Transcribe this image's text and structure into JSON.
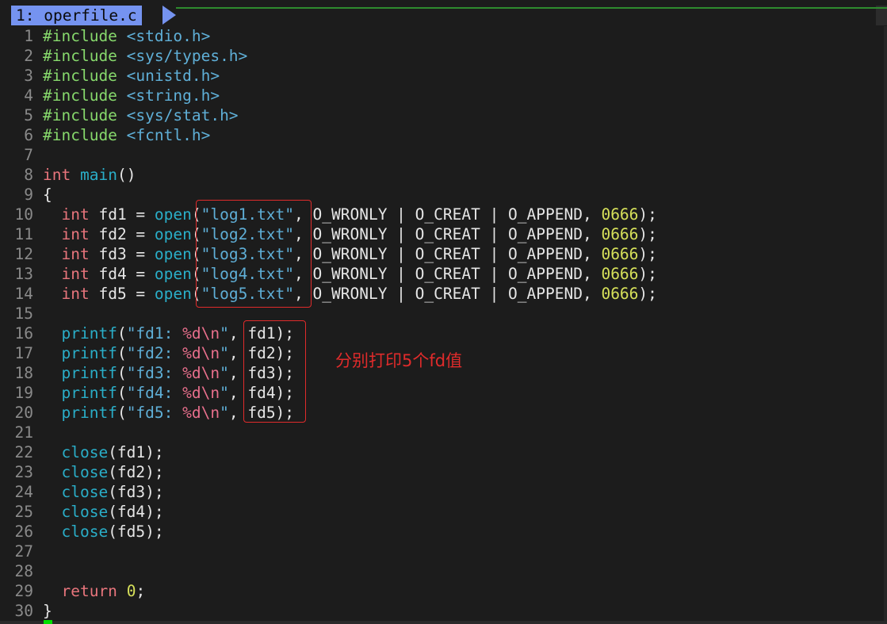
{
  "tabline": {
    "active_tab": "1: operfile.c"
  },
  "annotation": {
    "note": "分别打印5个fd值"
  },
  "colors": {
    "tab_active": "#7593f0",
    "preprocessor": "#87d96c",
    "include_path": "#5fafd7",
    "keyword": "#e8757c",
    "function": "#2aaec8",
    "string": "#5fafd7",
    "number": "#d6e05a",
    "format_spec": "#e86f8c",
    "annotation_red": "#e02b2b"
  },
  "lines": [
    {
      "n": "1",
      "tokens": [
        {
          "c": "pp",
          "t": "#include "
        },
        {
          "c": "inc",
          "t": "<stdio.h>"
        }
      ]
    },
    {
      "n": "2",
      "tokens": [
        {
          "c": "pp",
          "t": "#include "
        },
        {
          "c": "inc",
          "t": "<sys/types.h>"
        }
      ]
    },
    {
      "n": "3",
      "tokens": [
        {
          "c": "pp",
          "t": "#include "
        },
        {
          "c": "inc",
          "t": "<unistd.h>"
        }
      ]
    },
    {
      "n": "4",
      "tokens": [
        {
          "c": "pp",
          "t": "#include "
        },
        {
          "c": "inc",
          "t": "<string.h>"
        }
      ]
    },
    {
      "n": "5",
      "tokens": [
        {
          "c": "pp",
          "t": "#include "
        },
        {
          "c": "inc",
          "t": "<sys/stat.h>"
        }
      ]
    },
    {
      "n": "6",
      "tokens": [
        {
          "c": "pp",
          "t": "#include "
        },
        {
          "c": "inc",
          "t": "<fcntl.h>"
        }
      ]
    },
    {
      "n": "7",
      "tokens": []
    },
    {
      "n": "8",
      "tokens": [
        {
          "c": "kw",
          "t": "int"
        },
        {
          "c": "txt",
          "t": " "
        },
        {
          "c": "fn",
          "t": "main"
        },
        {
          "c": "txt",
          "t": "()"
        }
      ]
    },
    {
      "n": "9",
      "tokens": [
        {
          "c": "txt",
          "t": "{"
        }
      ]
    },
    {
      "n": "10",
      "tokens": [
        {
          "c": "txt",
          "t": "  "
        },
        {
          "c": "kw",
          "t": "int"
        },
        {
          "c": "txt",
          "t": " fd1 = "
        },
        {
          "c": "fn",
          "t": "open"
        },
        {
          "c": "txt",
          "t": "("
        },
        {
          "c": "str",
          "t": "\"log1.txt\""
        },
        {
          "c": "txt",
          "t": ", O_WRONLY | O_CREAT | O_APPEND, "
        },
        {
          "c": "num",
          "t": "0666"
        },
        {
          "c": "txt",
          "t": ");"
        }
      ]
    },
    {
      "n": "11",
      "tokens": [
        {
          "c": "txt",
          "t": "  "
        },
        {
          "c": "kw",
          "t": "int"
        },
        {
          "c": "txt",
          "t": " fd2 = "
        },
        {
          "c": "fn",
          "t": "open"
        },
        {
          "c": "txt",
          "t": "("
        },
        {
          "c": "str",
          "t": "\"log2.txt\""
        },
        {
          "c": "txt",
          "t": ", O_WRONLY | O_CREAT | O_APPEND, "
        },
        {
          "c": "num",
          "t": "0666"
        },
        {
          "c": "txt",
          "t": ");"
        }
      ]
    },
    {
      "n": "12",
      "tokens": [
        {
          "c": "txt",
          "t": "  "
        },
        {
          "c": "kw",
          "t": "int"
        },
        {
          "c": "txt",
          "t": " fd3 = "
        },
        {
          "c": "fn",
          "t": "open"
        },
        {
          "c": "txt",
          "t": "("
        },
        {
          "c": "str",
          "t": "\"log3.txt\""
        },
        {
          "c": "txt",
          "t": ", O_WRONLY | O_CREAT | O_APPEND, "
        },
        {
          "c": "num",
          "t": "0666"
        },
        {
          "c": "txt",
          "t": ");"
        }
      ]
    },
    {
      "n": "13",
      "tokens": [
        {
          "c": "txt",
          "t": "  "
        },
        {
          "c": "kw",
          "t": "int"
        },
        {
          "c": "txt",
          "t": " fd4 = "
        },
        {
          "c": "fn",
          "t": "open"
        },
        {
          "c": "txt",
          "t": "("
        },
        {
          "c": "str",
          "t": "\"log4.txt\""
        },
        {
          "c": "txt",
          "t": ", O_WRONLY | O_CREAT | O_APPEND, "
        },
        {
          "c": "num",
          "t": "0666"
        },
        {
          "c": "txt",
          "t": ");"
        }
      ]
    },
    {
      "n": "14",
      "tokens": [
        {
          "c": "txt",
          "t": "  "
        },
        {
          "c": "kw",
          "t": "int"
        },
        {
          "c": "txt",
          "t": " fd5 = "
        },
        {
          "c": "fn",
          "t": "open"
        },
        {
          "c": "txt",
          "t": "("
        },
        {
          "c": "str",
          "t": "\"log5.txt\""
        },
        {
          "c": "txt",
          "t": ", O_WRONLY | O_CREAT | O_APPEND, "
        },
        {
          "c": "num",
          "t": "0666"
        },
        {
          "c": "txt",
          "t": ");"
        }
      ]
    },
    {
      "n": "15",
      "tokens": []
    },
    {
      "n": "16",
      "tokens": [
        {
          "c": "txt",
          "t": "  "
        },
        {
          "c": "fn",
          "t": "printf"
        },
        {
          "c": "txt",
          "t": "("
        },
        {
          "c": "str",
          "t": "\"fd1: "
        },
        {
          "c": "fmt",
          "t": "%d\\n"
        },
        {
          "c": "str",
          "t": "\""
        },
        {
          "c": "txt",
          "t": ", fd1);"
        }
      ]
    },
    {
      "n": "17",
      "tokens": [
        {
          "c": "txt",
          "t": "  "
        },
        {
          "c": "fn",
          "t": "printf"
        },
        {
          "c": "txt",
          "t": "("
        },
        {
          "c": "str",
          "t": "\"fd2: "
        },
        {
          "c": "fmt",
          "t": "%d\\n"
        },
        {
          "c": "str",
          "t": "\""
        },
        {
          "c": "txt",
          "t": ", fd2);"
        }
      ]
    },
    {
      "n": "18",
      "tokens": [
        {
          "c": "txt",
          "t": "  "
        },
        {
          "c": "fn",
          "t": "printf"
        },
        {
          "c": "txt",
          "t": "("
        },
        {
          "c": "str",
          "t": "\"fd3: "
        },
        {
          "c": "fmt",
          "t": "%d\\n"
        },
        {
          "c": "str",
          "t": "\""
        },
        {
          "c": "txt",
          "t": ", fd3);"
        }
      ]
    },
    {
      "n": "19",
      "tokens": [
        {
          "c": "txt",
          "t": "  "
        },
        {
          "c": "fn",
          "t": "printf"
        },
        {
          "c": "txt",
          "t": "("
        },
        {
          "c": "str",
          "t": "\"fd4: "
        },
        {
          "c": "fmt",
          "t": "%d\\n"
        },
        {
          "c": "str",
          "t": "\""
        },
        {
          "c": "txt",
          "t": ", fd4);"
        }
      ]
    },
    {
      "n": "20",
      "tokens": [
        {
          "c": "txt",
          "t": "  "
        },
        {
          "c": "fn",
          "t": "printf"
        },
        {
          "c": "txt",
          "t": "("
        },
        {
          "c": "str",
          "t": "\"fd5: "
        },
        {
          "c": "fmt",
          "t": "%d\\n"
        },
        {
          "c": "str",
          "t": "\""
        },
        {
          "c": "txt",
          "t": ", fd5);"
        }
      ]
    },
    {
      "n": "21",
      "tokens": []
    },
    {
      "n": "22",
      "tokens": [
        {
          "c": "txt",
          "t": "  "
        },
        {
          "c": "fn",
          "t": "close"
        },
        {
          "c": "txt",
          "t": "(fd1);"
        }
      ]
    },
    {
      "n": "23",
      "tokens": [
        {
          "c": "txt",
          "t": "  "
        },
        {
          "c": "fn",
          "t": "close"
        },
        {
          "c": "txt",
          "t": "(fd2);"
        }
      ]
    },
    {
      "n": "24",
      "tokens": [
        {
          "c": "txt",
          "t": "  "
        },
        {
          "c": "fn",
          "t": "close"
        },
        {
          "c": "txt",
          "t": "(fd3);"
        }
      ]
    },
    {
      "n": "25",
      "tokens": [
        {
          "c": "txt",
          "t": "  "
        },
        {
          "c": "fn",
          "t": "close"
        },
        {
          "c": "txt",
          "t": "(fd4);"
        }
      ]
    },
    {
      "n": "26",
      "tokens": [
        {
          "c": "txt",
          "t": "  "
        },
        {
          "c": "fn",
          "t": "close"
        },
        {
          "c": "txt",
          "t": "(fd5);"
        }
      ]
    },
    {
      "n": "27",
      "tokens": []
    },
    {
      "n": "28",
      "tokens": []
    },
    {
      "n": "29",
      "tokens": [
        {
          "c": "txt",
          "t": "  "
        },
        {
          "c": "kw",
          "t": "return"
        },
        {
          "c": "txt",
          "t": " "
        },
        {
          "c": "num",
          "t": "0"
        },
        {
          "c": "txt",
          "t": ";"
        }
      ]
    },
    {
      "n": "30",
      "tokens": [
        {
          "c": "txt",
          "t": "}"
        }
      ]
    }
  ]
}
